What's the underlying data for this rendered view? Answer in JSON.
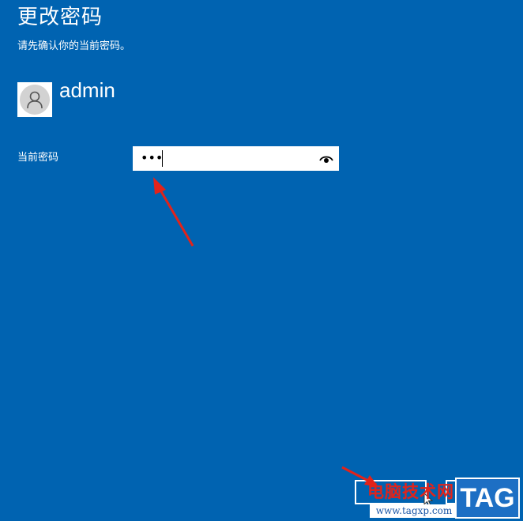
{
  "page": {
    "title": "更改密码",
    "subtitle": "请先确认你的当前密码。"
  },
  "account": {
    "username": "admin",
    "avatar_icon": "user-icon"
  },
  "form": {
    "current_password_label": "当前密码",
    "current_password_value": "•••",
    "reveal_icon": "eye-icon"
  },
  "buttons": {
    "next_label": "",
    "cancel_label": ""
  },
  "watermark": {
    "site_name": "电脑技术网",
    "url": "www.tagxp.com",
    "tag": "TAG"
  },
  "colors": {
    "background": "#0063b1",
    "annotation_arrow": "#e2231a",
    "watermark_red": "#e2231a",
    "watermark_blue": "#1d6fc4"
  }
}
